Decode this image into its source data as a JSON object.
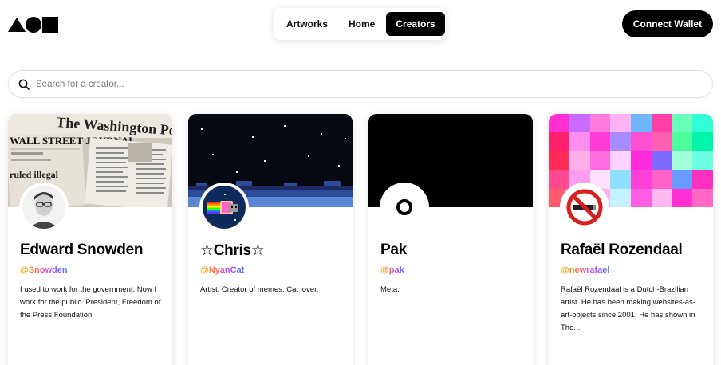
{
  "header": {
    "logo_icon": "aoh-logo-icon",
    "nav": [
      {
        "label": "Artworks",
        "active": false
      },
      {
        "label": "Home",
        "active": false
      },
      {
        "label": "Creators",
        "active": true
      }
    ],
    "connect_wallet_label": "Connect Wallet"
  },
  "search": {
    "placeholder": "Search for a creator...",
    "icon": "search-icon"
  },
  "creators": [
    {
      "name": "Edward Snowden",
      "handle": "@Snowden",
      "bio": "I used to work for the government. Now I work for the public. President, Freedom of the Press Foundation",
      "banner": {
        "headline_1": "The Washington Post",
        "headline_2": "WALL STREET JOURNAL",
        "headline_3": "ruled illegal"
      }
    },
    {
      "name": "☆Chris☆",
      "handle": "@NyanCat",
      "bio": "Artist. Creator of memes. Cat lover."
    },
    {
      "name": "Pak",
      "handle": "@pak",
      "bio": "Meta."
    },
    {
      "name": "Rafaël Rozendaal",
      "handle": "@newrafael",
      "bio": "Rafaël Rozendaal is a Dutch-Brazilian artist. He has been making websites-as-art-objects since 2001. He has shown in The..."
    }
  ],
  "colors": {
    "primary": "#000000",
    "background": "#ffffff",
    "handle_gradient": [
      "#f5b900",
      "#ff6a3d",
      "#c04bff",
      "#3b7bff"
    ]
  }
}
